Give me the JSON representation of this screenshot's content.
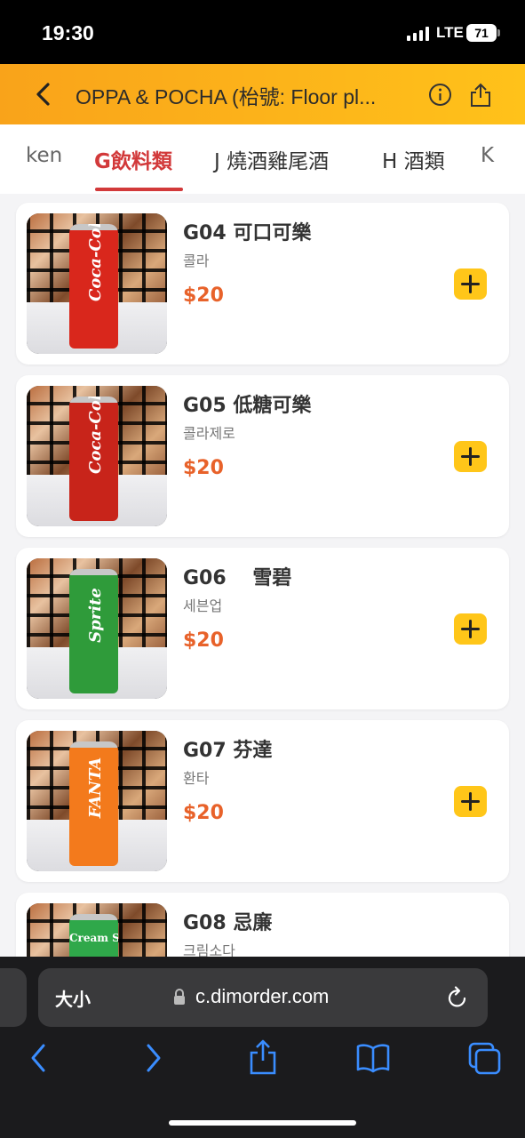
{
  "status_bar": {
    "time": "19:30",
    "network": "LTE",
    "battery": "71"
  },
  "header": {
    "title": "OPPA & POCHA (枱號: Floor pl..."
  },
  "tabs": [
    {
      "label": "ken"
    },
    {
      "label": "G飲料類"
    },
    {
      "label": "J 燒酒雞尾酒"
    },
    {
      "label": "H 酒類"
    },
    {
      "label": "K"
    }
  ],
  "active_tab": "G飲料類",
  "menu_items": [
    {
      "name": "G04 可口可樂",
      "subtitle": "콜라",
      "price": "$20",
      "brand": "Coca-Cola",
      "can_color": "#d9271c"
    },
    {
      "name": "G05 低糖可樂",
      "subtitle": "콜라제로",
      "price": "$20",
      "brand": "Coca-Cola",
      "can_color": "#c8241a"
    },
    {
      "name": "G06　 雪碧",
      "subtitle": "세븐업",
      "price": "$20",
      "brand": "Sprite",
      "can_color": "#2f9b3a"
    },
    {
      "name": "G07 芬達",
      "subtitle": "환타",
      "price": "$20",
      "brand": "FANTA",
      "can_color": "#f37a1c"
    },
    {
      "name": "G08 忌廉",
      "subtitle": "크림소다",
      "price": "",
      "brand": "Cream Soda",
      "can_color": "#2fa84a"
    }
  ],
  "browser": {
    "text_size_label": "大小",
    "domain": "c.dimorder.com"
  },
  "icons": [
    "back-icon",
    "info-icon",
    "share-icon",
    "lock-icon",
    "reload-icon",
    "nav-back-icon",
    "nav-forward-icon",
    "share-sheet-icon",
    "bookmarks-icon",
    "tabs-icon",
    "add-icon"
  ],
  "colors": {
    "accent": "#d2393a",
    "price": "#e8622a",
    "header": "#ffb31a",
    "add_button": "#ffc619"
  }
}
